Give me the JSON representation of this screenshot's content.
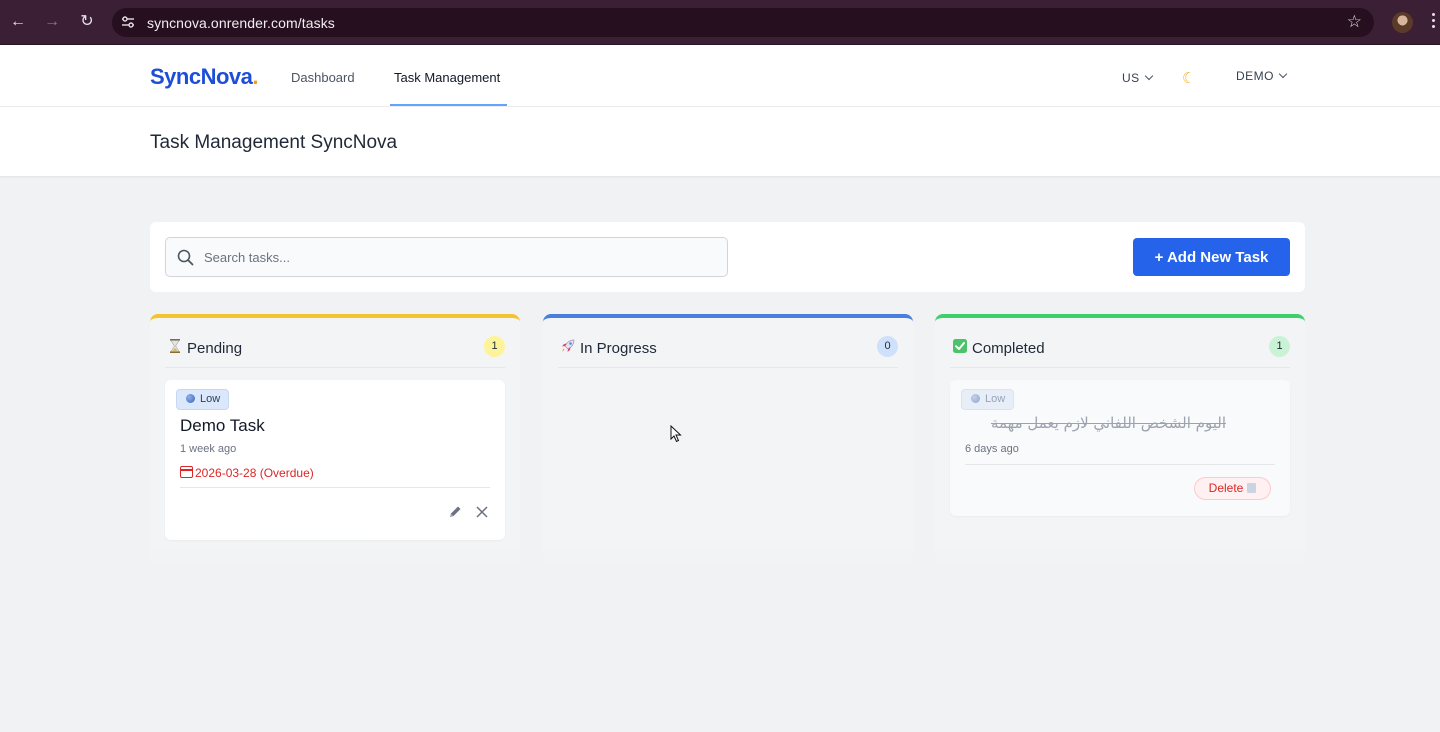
{
  "browser": {
    "url": "syncnova.onrender.com/tasks"
  },
  "header": {
    "logo": "SyncNova",
    "logo_dot": ".",
    "nav": [
      {
        "label": "Dashboard"
      },
      {
        "label": "Task Management"
      }
    ],
    "region": "US",
    "user": "DEMO"
  },
  "page": {
    "title": "Task Management SyncNova"
  },
  "toolbar": {
    "search_placeholder": "Search tasks...",
    "add_button": "+ Add New Task"
  },
  "columns": [
    {
      "title": "Pending",
      "count": "1",
      "icon": "hourglass-icon",
      "accent": "#f4c42c",
      "count_bg": "#fdf39a",
      "tasks": [
        {
          "priority": "Low",
          "title": "Demo Task",
          "created": "1 week ago",
          "due": "2026-03-28 (Overdue)"
        }
      ]
    },
    {
      "title": "In Progress",
      "count": "0",
      "icon": "rocket-icon",
      "accent": "#4a7fe0",
      "count_bg": "#cfe0fb",
      "tasks": []
    },
    {
      "title": "Completed",
      "count": "1",
      "icon": "check-box-icon",
      "accent": "#3fcf6a",
      "count_bg": "#c9f3d4",
      "tasks": [
        {
          "priority": "Low",
          "title": "اليوم الشخص اللفاني لازم يعمل مهمة",
          "created": "6 days ago",
          "delete_label": "Delete"
        }
      ]
    }
  ]
}
